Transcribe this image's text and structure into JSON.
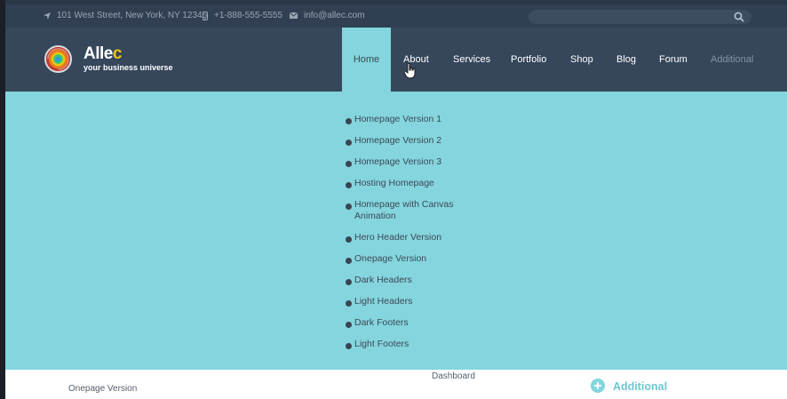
{
  "topbar": {
    "address": "101 West Street, New York, NY 12345",
    "phone": "+1-888-555-5555",
    "email": "info@allec.com",
    "search_placeholder": ""
  },
  "brand": {
    "name_main": "Alle",
    "name_accent": "c",
    "tagline": "your business universe",
    "accent_color": "#f1c40f"
  },
  "nav": [
    {
      "label": "Home",
      "active": true
    },
    {
      "label": "About"
    },
    {
      "label": "Services"
    },
    {
      "label": "Portfolio"
    },
    {
      "label": "Shop"
    },
    {
      "label": "Blog"
    },
    {
      "label": "Forum"
    },
    {
      "label": "Additional",
      "dimmed": true
    }
  ],
  "dropdown": {
    "items": [
      "Homepage Version 1",
      "Homepage Version 2",
      "Homepage Version 3",
      "Hosting Homepage",
      "Homepage with Canvas Animation",
      "Hero Header Version",
      "Onepage Version",
      "Dark Headers",
      "Light Headers",
      "Dark Footers",
      "Light Footers"
    ],
    "background": "#84d5de"
  },
  "footer": {
    "left": "Onepage Version",
    "center": "Dashboard",
    "right": "Additional"
  },
  "icons": {
    "location": "location-arrow-icon",
    "phone": "phone-icon",
    "email": "envelope-icon",
    "search": "search-icon",
    "logo": "spiral-logo-icon",
    "add": "plus-circle-icon"
  }
}
